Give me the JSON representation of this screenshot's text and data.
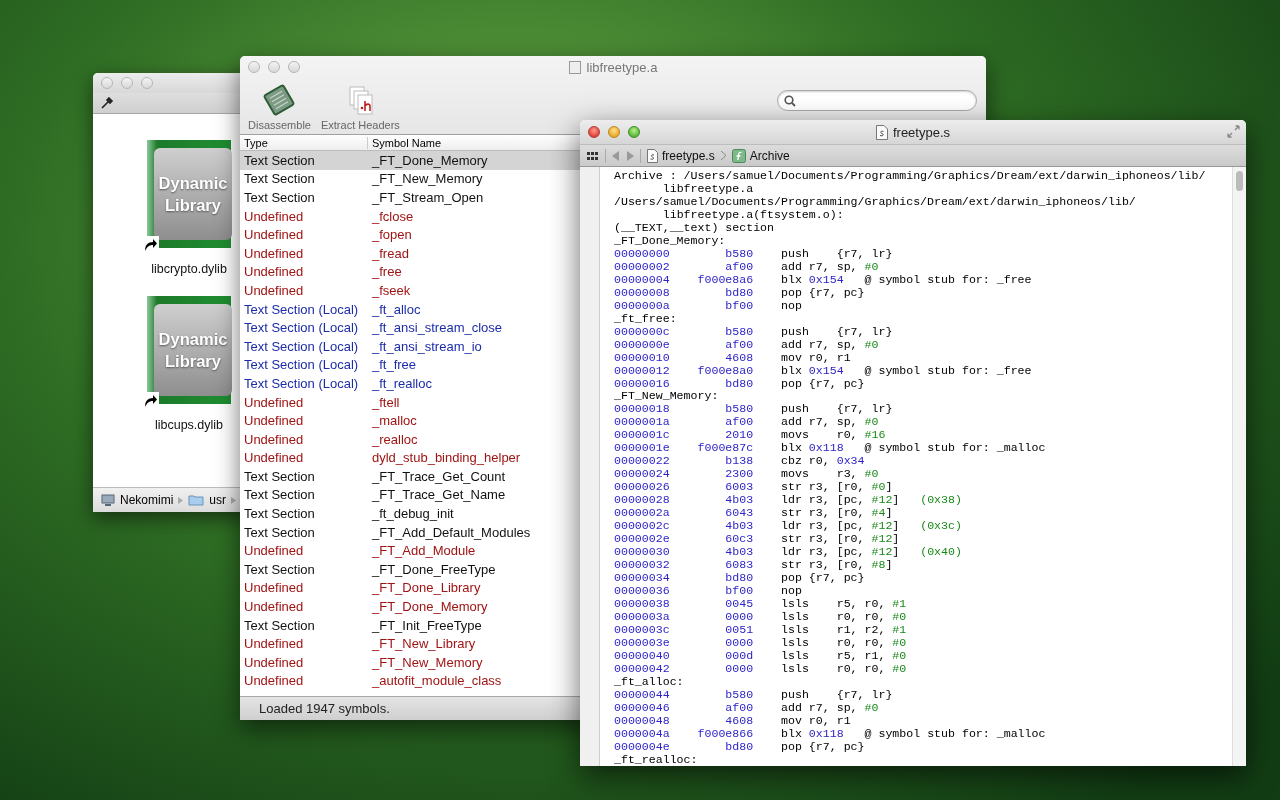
{
  "finder_window": {
    "active": false,
    "files": [
      {
        "icon_label": "Dynamic Library",
        "name": "libcrypto.dylib"
      },
      {
        "icon_label": "Dynamic Library",
        "name": "libcups.dylib"
      }
    ],
    "path_bar": [
      "Nekomimi",
      "usr"
    ]
  },
  "symbols_window": {
    "active": false,
    "title": "libfreetype.a",
    "toolbar": [
      {
        "kind": "disassemble",
        "label": "Disassemble"
      },
      {
        "kind": "headers",
        "label": "Extract Headers"
      }
    ],
    "table": {
      "columns": [
        "Type",
        "Symbol Name"
      ],
      "rows": [
        {
          "type": "Text Section",
          "name": "_FT_Done_Memory",
          "kind": "text",
          "selected": true
        },
        {
          "type": "Text Section",
          "name": "_FT_New_Memory",
          "kind": "text",
          "selected": false
        },
        {
          "type": "Text Section",
          "name": "_FT_Stream_Open",
          "kind": "text",
          "selected": false
        },
        {
          "type": "Undefined",
          "name": "_fclose",
          "kind": "undefined",
          "selected": false
        },
        {
          "type": "Undefined",
          "name": "_fopen",
          "kind": "undefined",
          "selected": false
        },
        {
          "type": "Undefined",
          "name": "_fread",
          "kind": "undefined",
          "selected": false
        },
        {
          "type": "Undefined",
          "name": "_free",
          "kind": "undefined",
          "selected": false
        },
        {
          "type": "Undefined",
          "name": "_fseek",
          "kind": "undefined",
          "selected": false
        },
        {
          "type": "Text Section (Local)",
          "name": "_ft_alloc",
          "kind": "local",
          "selected": false
        },
        {
          "type": "Text Section (Local)",
          "name": "_ft_ansi_stream_close",
          "kind": "local",
          "selected": false
        },
        {
          "type": "Text Section (Local)",
          "name": "_ft_ansi_stream_io",
          "kind": "local",
          "selected": false
        },
        {
          "type": "Text Section (Local)",
          "name": "_ft_free",
          "kind": "local",
          "selected": false
        },
        {
          "type": "Text Section (Local)",
          "name": "_ft_realloc",
          "kind": "local",
          "selected": false
        },
        {
          "type": "Undefined",
          "name": "_ftell",
          "kind": "undefined",
          "selected": false
        },
        {
          "type": "Undefined",
          "name": "_malloc",
          "kind": "undefined",
          "selected": false
        },
        {
          "type": "Undefined",
          "name": "_realloc",
          "kind": "undefined",
          "selected": false
        },
        {
          "type": "Undefined",
          "name": "dyld_stub_binding_helper",
          "kind": "undefined",
          "selected": false
        },
        {
          "type": "Text Section",
          "name": "_FT_Trace_Get_Count",
          "kind": "text",
          "selected": false
        },
        {
          "type": "Text Section",
          "name": "_FT_Trace_Get_Name",
          "kind": "text",
          "selected": false
        },
        {
          "type": "Text Section",
          "name": "_ft_debug_init",
          "kind": "text",
          "selected": false
        },
        {
          "type": "Text Section",
          "name": "_FT_Add_Default_Modules",
          "kind": "text",
          "selected": false
        },
        {
          "type": "Undefined",
          "name": "_FT_Add_Module",
          "kind": "undefined",
          "selected": false
        },
        {
          "type": "Text Section",
          "name": "_FT_Done_FreeType",
          "kind": "text",
          "selected": false
        },
        {
          "type": "Undefined",
          "name": "_FT_Done_Library",
          "kind": "undefined",
          "selected": false
        },
        {
          "type": "Undefined",
          "name": "_FT_Done_Memory",
          "kind": "undefined",
          "selected": false
        },
        {
          "type": "Text Section",
          "name": "_FT_Init_FreeType",
          "kind": "text",
          "selected": false
        },
        {
          "type": "Undefined",
          "name": "_FT_New_Library",
          "kind": "undefined",
          "selected": false
        },
        {
          "type": "Undefined",
          "name": "_FT_New_Memory",
          "kind": "undefined",
          "selected": false
        },
        {
          "type": "Undefined",
          "name": "_autofit_module_class",
          "kind": "undefined",
          "selected": false
        }
      ]
    },
    "status": "Loaded 1947 symbols."
  },
  "code_window": {
    "active": true,
    "title": "freetype.s",
    "breadcrumb": [
      {
        "kind": "file",
        "label": "freetype.s"
      },
      {
        "kind": "function",
        "label": "Archive"
      }
    ],
    "lines": [
      {
        "kind": "text",
        "text": "Archive : /Users/samuel/Documents/Programming/Graphics/Dream/ext/darwin_iphoneos/lib/"
      },
      {
        "kind": "cont",
        "text": "libfreetype.a"
      },
      {
        "kind": "text",
        "text": "/Users/samuel/Documents/Programming/Graphics/Dream/ext/darwin_iphoneos/lib/"
      },
      {
        "kind": "cont",
        "text": "libfreetype.a(ftsystem.o):"
      },
      {
        "kind": "text",
        "text": "(__TEXT,__text) section"
      },
      {
        "kind": "text",
        "text": "_FT_Done_Memory:"
      },
      {
        "kind": "instr",
        "addr": "00000000",
        "hex": "b580",
        "code": [
          {
            "kind": "plain",
            "text": "push    {r7, lr}"
          }
        ]
      },
      {
        "kind": "instr",
        "addr": "00000002",
        "hex": "af00",
        "code": [
          {
            "kind": "plain",
            "text": "add r7, sp, "
          },
          {
            "kind": "imm",
            "text": "#0"
          }
        ]
      },
      {
        "kind": "instr",
        "addr": "00000004",
        "hex": "f000e8a6",
        "code": [
          {
            "kind": "plain",
            "text": "blx "
          },
          {
            "kind": "addr",
            "text": "0x154"
          },
          {
            "kind": "plain",
            "text": "   @ symbol stub for: _free"
          }
        ]
      },
      {
        "kind": "instr",
        "addr": "00000008",
        "hex": "bd80",
        "code": [
          {
            "kind": "plain",
            "text": "pop {r7, pc}"
          }
        ]
      },
      {
        "kind": "instr",
        "addr": "0000000a",
        "hex": "bf00",
        "code": [
          {
            "kind": "plain",
            "text": "nop"
          }
        ]
      },
      {
        "kind": "text",
        "text": "_ft_free:"
      },
      {
        "kind": "instr",
        "addr": "0000000c",
        "hex": "b580",
        "code": [
          {
            "kind": "plain",
            "text": "push    {r7, lr}"
          }
        ]
      },
      {
        "kind": "instr",
        "addr": "0000000e",
        "hex": "af00",
        "code": [
          {
            "kind": "plain",
            "text": "add r7, sp, "
          },
          {
            "kind": "imm",
            "text": "#0"
          }
        ]
      },
      {
        "kind": "instr",
        "addr": "00000010",
        "hex": "4608",
        "code": [
          {
            "kind": "plain",
            "text": "mov r0, r1"
          }
        ]
      },
      {
        "kind": "instr",
        "addr": "00000012",
        "hex": "f000e8a0",
        "code": [
          {
            "kind": "plain",
            "text": "blx "
          },
          {
            "kind": "addr",
            "text": "0x154"
          },
          {
            "kind": "plain",
            "text": "   @ symbol stub for: _free"
          }
        ]
      },
      {
        "kind": "instr",
        "addr": "00000016",
        "hex": "bd80",
        "code": [
          {
            "kind": "plain",
            "text": "pop {r7, pc}"
          }
        ]
      },
      {
        "kind": "text",
        "text": "_FT_New_Memory:"
      },
      {
        "kind": "instr",
        "addr": "00000018",
        "hex": "b580",
        "code": [
          {
            "kind": "plain",
            "text": "push    {r7, lr}"
          }
        ]
      },
      {
        "kind": "instr",
        "addr": "0000001a",
        "hex": "af00",
        "code": [
          {
            "kind": "plain",
            "text": "add r7, sp, "
          },
          {
            "kind": "imm",
            "text": "#0"
          }
        ]
      },
      {
        "kind": "instr",
        "addr": "0000001c",
        "hex": "2010",
        "code": [
          {
            "kind": "plain",
            "text": "movs    r0, "
          },
          {
            "kind": "imm",
            "text": "#16"
          }
        ]
      },
      {
        "kind": "instr",
        "addr": "0000001e",
        "hex": "f000e87c",
        "code": [
          {
            "kind": "plain",
            "text": "blx "
          },
          {
            "kind": "addr",
            "text": "0x118"
          },
          {
            "kind": "plain",
            "text": "   @ symbol stub for: _malloc"
          }
        ]
      },
      {
        "kind": "instr",
        "addr": "00000022",
        "hex": "b138",
        "code": [
          {
            "kind": "plain",
            "text": "cbz r0, "
          },
          {
            "kind": "addr",
            "text": "0x34"
          }
        ]
      },
      {
        "kind": "instr",
        "addr": "00000024",
        "hex": "2300",
        "code": [
          {
            "kind": "plain",
            "text": "movs    r3, "
          },
          {
            "kind": "imm",
            "text": "#0"
          }
        ]
      },
      {
        "kind": "instr",
        "addr": "00000026",
        "hex": "6003",
        "code": [
          {
            "kind": "plain",
            "text": "str r3, [r0, "
          },
          {
            "kind": "imm",
            "text": "#0"
          },
          {
            "kind": "plain",
            "text": "]"
          }
        ]
      },
      {
        "kind": "instr",
        "addr": "00000028",
        "hex": "4b03",
        "code": [
          {
            "kind": "plain",
            "text": "ldr r3, [pc, "
          },
          {
            "kind": "imm",
            "text": "#12"
          },
          {
            "kind": "plain",
            "text": "]   "
          },
          {
            "kind": "imm",
            "text": "(0x38)"
          }
        ]
      },
      {
        "kind": "instr",
        "addr": "0000002a",
        "hex": "6043",
        "code": [
          {
            "kind": "plain",
            "text": "str r3, [r0, "
          },
          {
            "kind": "imm",
            "text": "#4"
          },
          {
            "kind": "plain",
            "text": "]"
          }
        ]
      },
      {
        "kind": "instr",
        "addr": "0000002c",
        "hex": "4b03",
        "code": [
          {
            "kind": "plain",
            "text": "ldr r3, [pc, "
          },
          {
            "kind": "imm",
            "text": "#12"
          },
          {
            "kind": "plain",
            "text": "]   "
          },
          {
            "kind": "imm",
            "text": "(0x3c)"
          }
        ]
      },
      {
        "kind": "instr",
        "addr": "0000002e",
        "hex": "60c3",
        "code": [
          {
            "kind": "plain",
            "text": "str r3, [r0, "
          },
          {
            "kind": "imm",
            "text": "#12"
          },
          {
            "kind": "plain",
            "text": "]"
          }
        ]
      },
      {
        "kind": "instr",
        "addr": "00000030",
        "hex": "4b03",
        "code": [
          {
            "kind": "plain",
            "text": "ldr r3, [pc, "
          },
          {
            "kind": "imm",
            "text": "#12"
          },
          {
            "kind": "plain",
            "text": "]   "
          },
          {
            "kind": "imm",
            "text": "(0x40)"
          }
        ]
      },
      {
        "kind": "instr",
        "addr": "00000032",
        "hex": "6083",
        "code": [
          {
            "kind": "plain",
            "text": "str r3, [r0, "
          },
          {
            "kind": "imm",
            "text": "#8"
          },
          {
            "kind": "plain",
            "text": "]"
          }
        ]
      },
      {
        "kind": "instr",
        "addr": "00000034",
        "hex": "bd80",
        "code": [
          {
            "kind": "plain",
            "text": "pop {r7, pc}"
          }
        ]
      },
      {
        "kind": "instr",
        "addr": "00000036",
        "hex": "bf00",
        "code": [
          {
            "kind": "plain",
            "text": "nop"
          }
        ]
      },
      {
        "kind": "instr",
        "addr": "00000038",
        "hex": "0045",
        "code": [
          {
            "kind": "plain",
            "text": "lsls    r5, r0, "
          },
          {
            "kind": "imm",
            "text": "#1"
          }
        ]
      },
      {
        "kind": "instr",
        "addr": "0000003a",
        "hex": "0000",
        "code": [
          {
            "kind": "plain",
            "text": "lsls    r0, r0, "
          },
          {
            "kind": "imm",
            "text": "#0"
          }
        ]
      },
      {
        "kind": "instr",
        "addr": "0000003c",
        "hex": "0051",
        "code": [
          {
            "kind": "plain",
            "text": "lsls    r1, r2, "
          },
          {
            "kind": "imm",
            "text": "#1"
          }
        ]
      },
      {
        "kind": "instr",
        "addr": "0000003e",
        "hex": "0000",
        "code": [
          {
            "kind": "plain",
            "text": "lsls    r0, r0, "
          },
          {
            "kind": "imm",
            "text": "#0"
          }
        ]
      },
      {
        "kind": "instr",
        "addr": "00000040",
        "hex": "000d",
        "code": [
          {
            "kind": "plain",
            "text": "lsls    r5, r1, "
          },
          {
            "kind": "imm",
            "text": "#0"
          }
        ]
      },
      {
        "kind": "instr",
        "addr": "00000042",
        "hex": "0000",
        "code": [
          {
            "kind": "plain",
            "text": "lsls    r0, r0, "
          },
          {
            "kind": "imm",
            "text": "#0"
          }
        ]
      },
      {
        "kind": "text",
        "text": "_ft_alloc:"
      },
      {
        "kind": "instr",
        "addr": "00000044",
        "hex": "b580",
        "code": [
          {
            "kind": "plain",
            "text": "push    {r7, lr}"
          }
        ]
      },
      {
        "kind": "instr",
        "addr": "00000046",
        "hex": "af00",
        "code": [
          {
            "kind": "plain",
            "text": "add r7, sp, "
          },
          {
            "kind": "imm",
            "text": "#0"
          }
        ]
      },
      {
        "kind": "instr",
        "addr": "00000048",
        "hex": "4608",
        "code": [
          {
            "kind": "plain",
            "text": "mov r0, r1"
          }
        ]
      },
      {
        "kind": "instr",
        "addr": "0000004a",
        "hex": "f000e866",
        "code": [
          {
            "kind": "plain",
            "text": "blx "
          },
          {
            "kind": "addr",
            "text": "0x118"
          },
          {
            "kind": "plain",
            "text": "   @ symbol stub for: _malloc"
          }
        ]
      },
      {
        "kind": "instr",
        "addr": "0000004e",
        "hex": "bd80",
        "code": [
          {
            "kind": "plain",
            "text": "pop {r7, pc}"
          }
        ]
      },
      {
        "kind": "text",
        "text": "_ft_realloc:"
      }
    ]
  }
}
